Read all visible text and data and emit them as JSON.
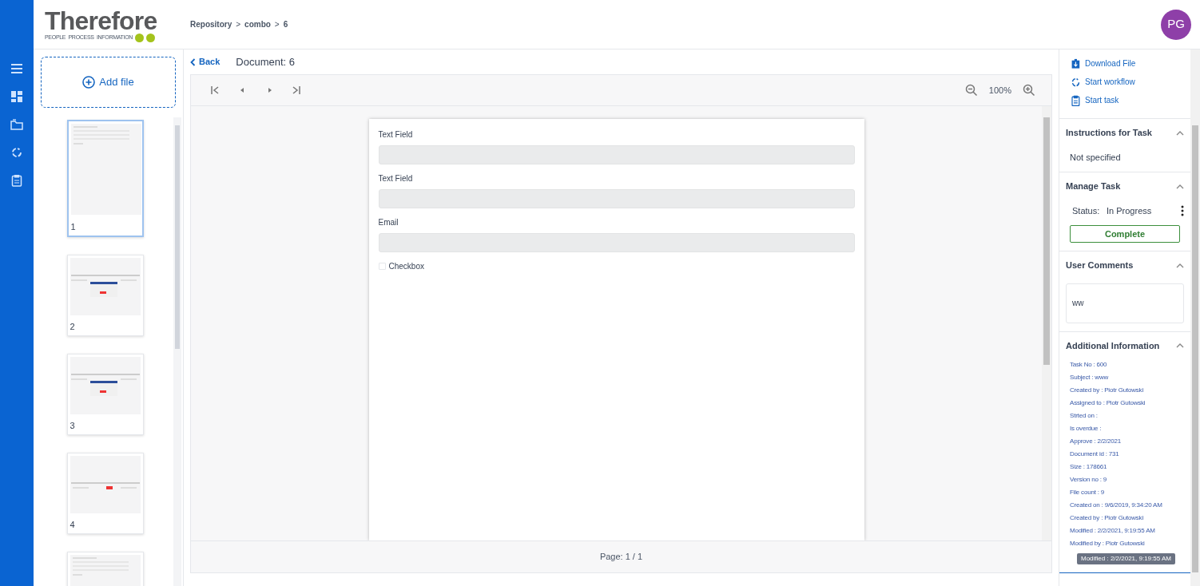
{
  "header": {
    "logo": "Therefore",
    "tagline": "PEOPLE  PROCESS  INFORMATION",
    "breadcrumb": [
      "Repository",
      "combo",
      "6"
    ],
    "separator": ">",
    "avatar": "PG"
  },
  "rail": [
    {
      "kind": "menu"
    },
    {
      "kind": "dashboard"
    },
    {
      "kind": "folder"
    },
    {
      "kind": "sync"
    },
    {
      "kind": "clipboard"
    }
  ],
  "files": {
    "add_label": "Add file",
    "thumbnails": [
      {
        "label": "1",
        "selected": true,
        "kind": "form"
      },
      {
        "label": "2",
        "selected": false,
        "kind": "screen"
      },
      {
        "label": "3",
        "selected": false,
        "kind": "screen"
      },
      {
        "label": "4",
        "selected": false,
        "kind": "table"
      },
      {
        "selected": false,
        "kind": "form"
      }
    ]
  },
  "viewer": {
    "back": "Back",
    "title": "Document: 6",
    "zoom": "100%",
    "page": "Page: 1 / 1",
    "fields": [
      {
        "kind": "text",
        "label": "Text Field"
      },
      {
        "kind": "text",
        "label": "Text Field"
      },
      {
        "kind": "text",
        "label": "Email"
      },
      {
        "kind": "checkbox",
        "label": "Checkbox",
        "checked": false
      }
    ]
  },
  "actions": [
    {
      "kind": "download",
      "label": "Download File"
    },
    {
      "kind": "workflow",
      "label": "Start workflow"
    },
    {
      "kind": "task",
      "label": "Start task"
    }
  ],
  "instructions": {
    "title": "Instructions for Task",
    "expanded": true,
    "text": "Not specified"
  },
  "manage": {
    "title": "Manage Task",
    "expanded": true,
    "status_label": "Status:",
    "status": "In Progress",
    "button": "Complete"
  },
  "comments": {
    "title": "User Comments",
    "expanded": true,
    "value": "ww"
  },
  "info": {
    "title": "Additional Information",
    "expanded": true,
    "items": [
      "Task No : 600",
      "Subject : www",
      "Created by : Piotr Gutowski",
      "Assigned to : Piotr Gutowski",
      "Strted on :",
      "Is overdue :",
      "Approve : 2/2/2021",
      "Document id : 731",
      "Size : 178661",
      "Version no : 9",
      "File count : 9",
      "Created on : 9/6/2019, 9:34:20 AM",
      "Created by : Piotr Gutowski",
      "Modified : 2/2/2021, 9:19:55 AM",
      "Modified by : Piotr Gutowski"
    ],
    "tooltip": "Modified : 2/2/2021, 9:19:55 AM"
  }
}
